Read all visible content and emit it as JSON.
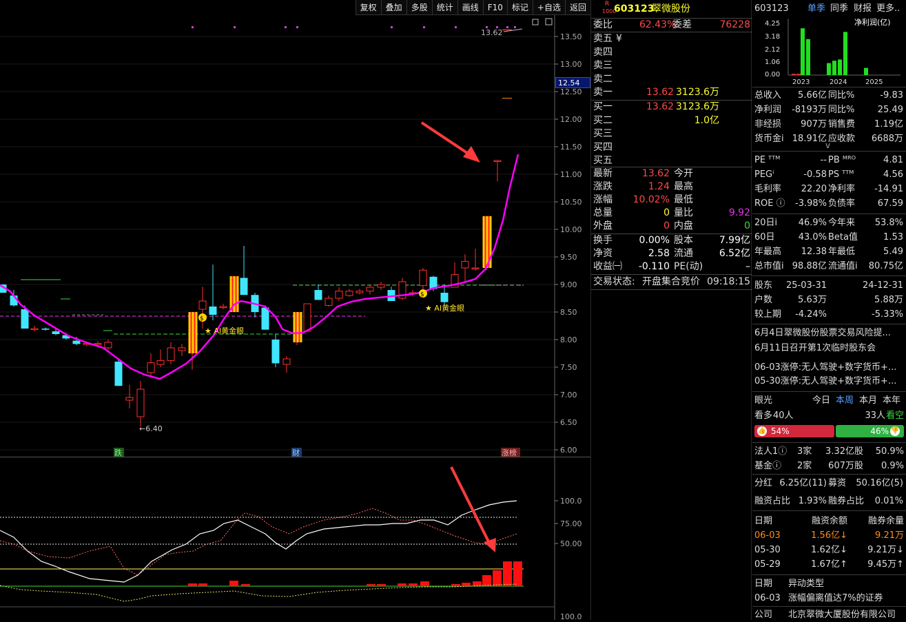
{
  "toolbar": [
    "复权",
    "叠加",
    "多股",
    "统计",
    "画线",
    "F10",
    "标记",
    "+自选",
    "返回"
  ],
  "kline": {
    "y_labels": [
      "13.50",
      "13.00",
      "12.50",
      "12.00",
      "11.50",
      "11.00",
      "10.50",
      "10.00",
      "9.50",
      "9.00",
      "8.50",
      "8.00",
      "7.50",
      "7.00",
      "6.50",
      "6.00"
    ],
    "current_price_tag": "12.54",
    "high_label": "13.62",
    "low_label": "6.40",
    "ai_labels": [
      "★ AI黄金眼",
      "★ AI黄金眼"
    ],
    "event_markers": [
      "跌",
      "财",
      "涨榜"
    ],
    "colors": {
      "up": "#ff3030",
      "down": "#40e6ff",
      "ma": "#ff00ff",
      "limit_up": "#ffcc00"
    }
  },
  "osc": {
    "y_labels": [
      "100.0",
      "75.00",
      "50.00"
    ],
    "y_label_bottom": "100.0"
  },
  "order": {
    "code": "603123",
    "name": "翠微股份",
    "r_badge": "R",
    "l_badge": "1000",
    "weibi": {
      "label": "委比",
      "value": "62.43%",
      "label2": "委差",
      "value2": "76228"
    },
    "sell": [
      {
        "label": "卖五",
        "price": "",
        "vol": "",
        "extra": "¥"
      },
      {
        "label": "卖四",
        "price": "",
        "vol": ""
      },
      {
        "label": "卖三",
        "price": "",
        "vol": ""
      },
      {
        "label": "卖二",
        "price": "",
        "vol": ""
      },
      {
        "label": "卖一",
        "price": "13.62",
        "vol": "3123.6万"
      }
    ],
    "buy": [
      {
        "label": "买一",
        "price": "13.62",
        "vol": "3123.6万"
      },
      {
        "label": "买二",
        "price": "",
        "vol": "1.0亿"
      },
      {
        "label": "买三",
        "price": "",
        "vol": ""
      },
      {
        "label": "买四",
        "price": "",
        "vol": ""
      },
      {
        "label": "买五",
        "price": "",
        "vol": ""
      }
    ],
    "quote": [
      {
        "l": "最新",
        "v": "13.62",
        "l2": "今开",
        "v2": ""
      },
      {
        "l": "涨跌",
        "v": "1.24",
        "l2": "最高",
        "v2": ""
      },
      {
        "l": "涨幅",
        "v": "10.02%",
        "l2": "最低",
        "v2": ""
      },
      {
        "l": "总量",
        "v": "0",
        "l2": "量比",
        "v2": "9.92"
      },
      {
        "l": "外盘",
        "v": "0",
        "l2": "内盘",
        "v2": "0"
      }
    ],
    "stats": [
      {
        "l": "换手",
        "v": "0.00%",
        "l2": "股本",
        "v2": "7.99亿"
      },
      {
        "l": "净资",
        "v": "2.58",
        "l2": "流通",
        "v2": "6.52亿"
      },
      {
        "l": "收益㈠",
        "v": "-0.110",
        "l2": "PE(动)",
        "v2": "–"
      }
    ],
    "trade_status": {
      "label": "交易状态:",
      "value": "开盘集合竞价",
      "time": "09:18:15"
    }
  },
  "info": {
    "header": {
      "code": "603123",
      "tabs": [
        "单季",
        "同季",
        "财报",
        "更多.."
      ]
    },
    "mini_chart": {
      "title": "净利润(亿)",
      "y_labels": [
        "4.25",
        "3.18",
        "2.12",
        "1.06",
        "0.00"
      ],
      "x_labels": [
        "2023",
        "2024",
        "2025"
      ],
      "bars": [
        0.1,
        0.1,
        3.9,
        3.0,
        1.0,
        1.2,
        1.3,
        3.6,
        0.6
      ]
    },
    "fin": [
      {
        "l": "总收入",
        "v": "5.66亿",
        "l2": "同比%",
        "v2": "-9.83"
      },
      {
        "l": "净利润",
        "v": "-8193万",
        "l2": "同比%",
        "v2": "25.49"
      },
      {
        "l": "非经损",
        "v": "907万",
        "l2": "销售费",
        "v2": "1.19亿"
      },
      {
        "l": "货币金i",
        "v": "18.91亿",
        "l2": "应收款",
        "v2": "6688万"
      }
    ],
    "expand_chevron": "v",
    "val": [
      {
        "l": "PE ᵀᵀᴹ",
        "v": "--",
        "l2": "PB ᴹᴿᴼ",
        "v2": "4.81"
      },
      {
        "l": "PEGⁱ",
        "v": "-0.58",
        "l2": "PS ᵀᵀᴹ",
        "v2": "4.56"
      },
      {
        "l": "毛利率",
        "v": "22.20",
        "l2": "净利率",
        "v2": "-14.91"
      },
      {
        "l": "ROE ⓘ",
        "v": "-3.98%",
        "l2": "负债率",
        "v2": "67.59"
      }
    ],
    "perf": [
      {
        "l": "20日i",
        "v": "46.9%",
        "l2": "今年来",
        "v2": "53.8%"
      },
      {
        "l": "60日",
        "v": "43.0%",
        "l2": "Beta值",
        "v2": "1.53"
      },
      {
        "l": "年最高",
        "v": "12.38",
        "l2": "年最低",
        "v2": "5.49"
      },
      {
        "l": "总市值i",
        "v": "98.88亿",
        "l2": "流通值i",
        "v2": "80.75亿"
      }
    ],
    "holders": [
      {
        "l": "股东",
        "v": "25-03-31",
        "v2": "24-12-31"
      },
      {
        "l": "户数",
        "v": "5.63万",
        "v2": "5.88万"
      },
      {
        "l": "较上期",
        "v": "-4.24%",
        "v2": "-5.33%"
      }
    ],
    "news": [
      "6月4日翠微股份股票交易风险提...",
      "6月11日召开第1次临时股东会",
      "06-03涨停:无人驾驶+数字货币+...",
      "05-30涨停:无人驾驶+数字货币+..."
    ],
    "yanguang": {
      "title": "眼光",
      "tabs": [
        "今日",
        "本周",
        "本月",
        "本年"
      ],
      "bull_label": "看多",
      "bull_count": "40人",
      "bear_count": "33人",
      "bear_label": "看空",
      "bull_pct": "54%",
      "bear_pct": "46%",
      "bull_value": 54
    },
    "inst": [
      {
        "l": "法人1ⓘ",
        "a": "3家",
        "b": "3.32亿股",
        "c": "50.9%"
      },
      {
        "l": "基金ⓘ",
        "a": "2家",
        "b": "607万股",
        "c": "0.9%"
      }
    ],
    "fenhong": {
      "l": "分红",
      "v": "6.25亿(11)",
      "l2": "募资",
      "v2": "50.16亿(5)"
    },
    "rzrq": {
      "l": "融资占比",
      "v": "1.93%",
      "l2": "融券占比",
      "v2": "0.01%"
    },
    "margin": {
      "headers": [
        "日期",
        "融资余额",
        "融券余量"
      ],
      "rows": [
        [
          "06-03",
          "1.56亿↓",
          "9.21万"
        ],
        [
          "05-30",
          "1.62亿↓",
          "9.21万↓"
        ],
        [
          "05-29",
          "1.67亿↑",
          "9.45万↑"
        ]
      ]
    },
    "yidong": {
      "headers": [
        "日期",
        "异动类型"
      ],
      "rows": [
        [
          "06-03",
          "涨幅偏离值达7%的证券"
        ]
      ]
    },
    "company": {
      "l": "公司",
      "v": "北京翠微大厦股份有限公司"
    }
  }
}
